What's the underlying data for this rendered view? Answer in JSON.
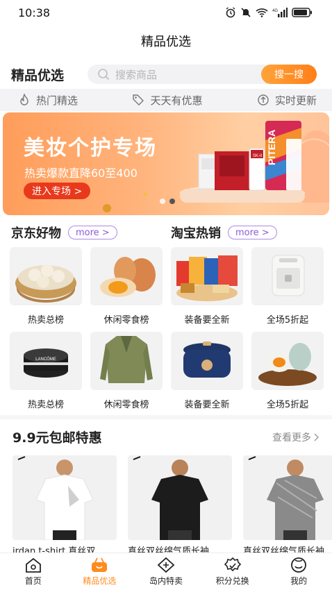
{
  "status": {
    "time": "10:38",
    "icons": [
      "alarm-icon",
      "mute-icon",
      "wifi-icon",
      "signal-4g-icon",
      "battery-icon"
    ]
  },
  "page": {
    "title": "精品优选"
  },
  "header": {
    "section_label": "精品优选"
  },
  "search": {
    "placeholder": "搜索商品",
    "button": "搜一搜"
  },
  "features": [
    {
      "label": "热门精选",
      "icon": "flame-icon"
    },
    {
      "label": "天天有优惠",
      "icon": "coupon-tag-icon"
    },
    {
      "label": "实时更新",
      "icon": "refresh-up-icon"
    }
  ],
  "banner": {
    "title": "美妆个护专场",
    "subtitle": "热卖爆款直降60至400",
    "cta": "进入专场 >",
    "slides": 2,
    "active_slide": 1,
    "product_text": [
      "SK-II",
      "PITERA"
    ]
  },
  "categories": [
    {
      "title": "京东好物",
      "more": "more >"
    },
    {
      "title": "淘宝热销",
      "more": "more >"
    }
  ],
  "products": [
    {
      "label": "热卖总榜",
      "image": "dumplings-steamer"
    },
    {
      "label": "休闲零食榜",
      "image": "eggs"
    },
    {
      "label": "装备要全新",
      "image": "snacks-pile"
    },
    {
      "label": "全场5折起",
      "image": "air-fryer"
    },
    {
      "label": "热卖总榜",
      "image": "lancome-cream-jar",
      "brand_text": "LANCÔME"
    },
    {
      "label": "休闲零食榜",
      "image": "green-blazer"
    },
    {
      "label": "装备要全新",
      "image": "rice-cooker"
    },
    {
      "label": "全场5折起",
      "image": "salted-eggs"
    }
  ],
  "deals": {
    "title": "9.9元包邮特惠",
    "more": "查看更多",
    "items": [
      {
        "caption": "jrdan t-shirt 真丝双",
        "shirt_color": "#ffffff"
      },
      {
        "caption": "真丝双丝绵气质长袖",
        "shirt_color": "#222222"
      },
      {
        "caption": "真丝双丝绵气质长袖",
        "shirt_color": "#888888"
      }
    ]
  },
  "tabs": [
    {
      "label": "首页",
      "icon": "home-icon",
      "active": false
    },
    {
      "label": "精品优选",
      "icon": "basket-icon",
      "active": true
    },
    {
      "label": "岛内特卖",
      "icon": "tag-icon",
      "active": false
    },
    {
      "label": "积分兑换",
      "icon": "gift-points-icon",
      "active": false
    },
    {
      "label": "我的",
      "icon": "smiley-profile-icon",
      "active": false
    }
  ],
  "colors": {
    "accent": "#ff8a1e",
    "banner_btn": "#e8391d",
    "more_pill": "#8a5ad6"
  }
}
